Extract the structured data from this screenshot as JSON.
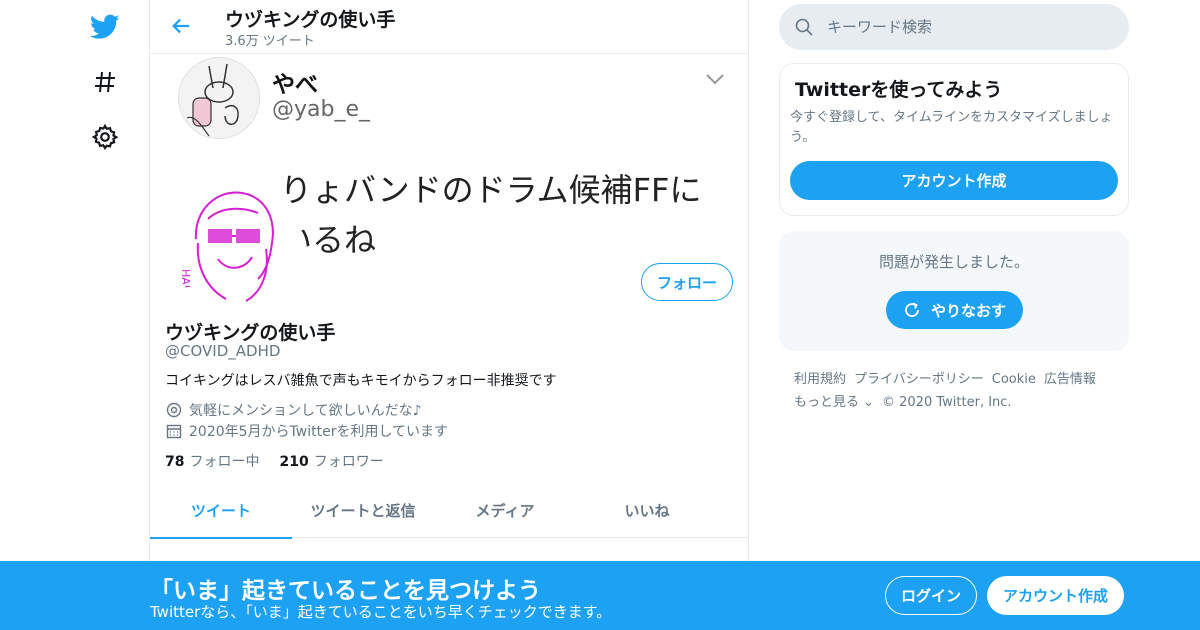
{
  "nav": {
    "items": [
      {
        "icon": "twitter-bird-icon",
        "color": "#1da1f2"
      },
      {
        "icon": "hashtag-icon",
        "glyph": "#"
      },
      {
        "icon": "gear-icon"
      }
    ]
  },
  "header": {
    "title": "ウヅキングの使い手",
    "subtitle": "3.6万 ツイート"
  },
  "banner": {
    "name": "やべ",
    "handle": "@yab_e_",
    "text": "りょバンドのドラム候補FFにいるね"
  },
  "profile": {
    "name": "ウヅキングの使い手",
    "handle": "@COVID_ADHD",
    "bio": "コイキングはレスバ雑魚で声もキモイからフォロー非推奨です",
    "location": "気軽にメンションして欲しいんだな♪",
    "joined": "2020年5月からTwitterを利用しています",
    "following_count": "78",
    "following_label": "フォロー中",
    "followers_count": "210",
    "followers_label": "フォロワー",
    "follow_button": "フォロー"
  },
  "tabs": [
    {
      "label": "ツイート",
      "active": true
    },
    {
      "label": "ツイートと返信",
      "active": false
    },
    {
      "label": "メディア",
      "active": false
    },
    {
      "label": "いいね",
      "active": false
    }
  ],
  "search": {
    "placeholder": "キーワード検索"
  },
  "signup_card": {
    "title": "Twitterを使ってみよう",
    "description": "今すぐ登録して、タイムラインをカスタマイズしましょう。",
    "button": "アカウント作成"
  },
  "error_card": {
    "message": "問題が発生しました。",
    "retry": "やりなおす"
  },
  "footer": {
    "links": [
      "利用規約",
      "プライバシーポリシー",
      "Cookie",
      "広告情報",
      "もっと見る ⌄"
    ],
    "copyright": "© 2020 Twitter, Inc."
  },
  "bottom_bar": {
    "title": "「いま」起きていることを見つけよう",
    "subtitle": "Twitterなら、「いま」起きていることをいち早くチェックできます。",
    "login": "ログイン",
    "signup": "アカウント作成"
  },
  "colors": {
    "accent": "#1da1f2",
    "secondary_text": "#657786",
    "border": "#e6ecf0"
  }
}
